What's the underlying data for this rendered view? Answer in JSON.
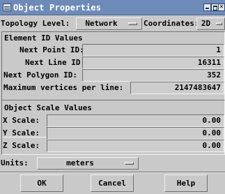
{
  "window": {
    "title": "Object Properties",
    "icon": "window-menu-icon"
  },
  "topology": {
    "label": "Topology Level:",
    "value": "Network"
  },
  "coordinates": {
    "label": "Coordinates:",
    "value": "2D"
  },
  "element_ids": {
    "heading": "Element ID Values",
    "next_point": {
      "label": "Next Point ID:",
      "value": "1"
    },
    "next_line": {
      "label": "Next Line ID:",
      "value": "16311"
    },
    "next_polygon": {
      "label": "Next Polygon ID:",
      "value": "352"
    },
    "max_vertices": {
      "label": "Maximum vertices per line:",
      "value": "2147483647"
    }
  },
  "scale": {
    "heading": "Object Scale Values",
    "x": {
      "label": "X Scale:",
      "value": "0.00"
    },
    "y": {
      "label": "Y Scale:",
      "value": "0.00"
    },
    "z": {
      "label": "Z Scale:",
      "value": "0.00"
    }
  },
  "units": {
    "label": "Units:",
    "value": "meters"
  },
  "buttons": {
    "ok": "OK",
    "cancel": "Cancel",
    "help": "Help"
  },
  "colors": {
    "titlebar": "#6d8ab8",
    "background": "#c9c9c9"
  }
}
